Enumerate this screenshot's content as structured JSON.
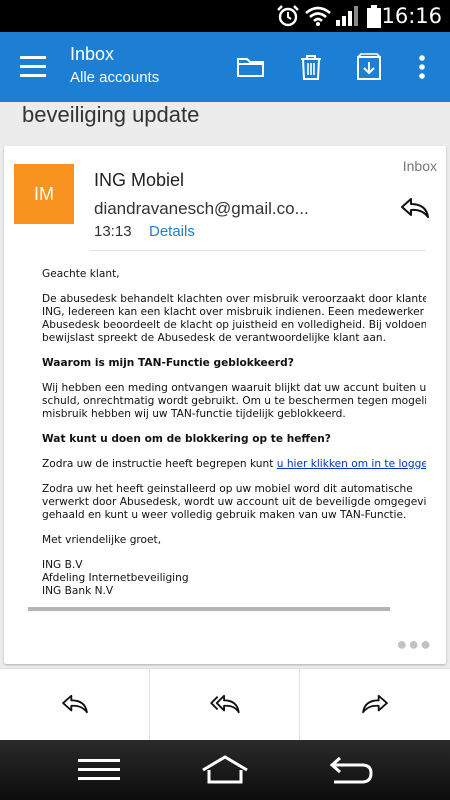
{
  "status_bar": {
    "time": "16:16"
  },
  "app_bar": {
    "title": "Inbox",
    "subtitle": "Alle accounts"
  },
  "subject": "beveiliging update",
  "message": {
    "folder": "Inbox",
    "avatar_initials": "IM",
    "avatar_color": "#f7931e",
    "sender": "ING Mobiel",
    "email": "diandravanesch@gmail.co...",
    "time": "13:13",
    "details_link": "Details"
  },
  "body": {
    "greeting": "Geachte klant,",
    "para1_line1": "De abusedesk behandelt klachten over misbruik veroorzaakt door klanten van",
    "para1_line2": "ING, Iedereen kan een klacht over misbruik indienen. Eeen medewerker van de",
    "para1_line3": "Abusedesk beoordeelt de klacht op juistheid en volledigheid. Bij voldoende",
    "para1_line4": "bewijslast spreekt de Abusedesk de verantwoordelijke klant aan.",
    "heading1": "Waarom is mijn TAN-Functie geblokkeerd?",
    "para2_line1": "Wij hebben een meding ontvangen waaruit blijkt dat uw accunt buiten uw",
    "para2_line2": "schuld, onrechtmatig wordt gebruikt. Om u te beschermen tegen mogelijk",
    "para2_line3": "misbruik hebben wij uw TAN-functie tijdelijk geblokkeerd.",
    "heading2": "Wat kunt u doen om de blokkering op te heffen?",
    "para3_text": "Zodra uw de instructie heeft begrepen kunt ",
    "para3_link": "u hier klikken om in te loggen.",
    "para4_line1": "Zodra uw het heeft geinstalleerd op uw mobiel word dit automatische",
    "para4_line2": "verwerkt door Abusedesk, wordt uw account uit de beveiligde omgegeving",
    "para4_line3": "gehaald en kunt u weer volledig gebruik maken van uw TAN-Functie.",
    "closing": "Met vriendelijke groet,",
    "sig1": "ING B.V",
    "sig2": "Afdeling Internetbeveiliging",
    "sig3": "ING Bank N.V"
  },
  "icons": {
    "menu": "hamburger-icon",
    "move": "folder-icon",
    "delete": "trash-icon",
    "archive": "archive-icon",
    "overflow": "more-vertical-icon"
  },
  "colors": {
    "appbar": "#1c7fd4",
    "link": "#0033cc"
  }
}
